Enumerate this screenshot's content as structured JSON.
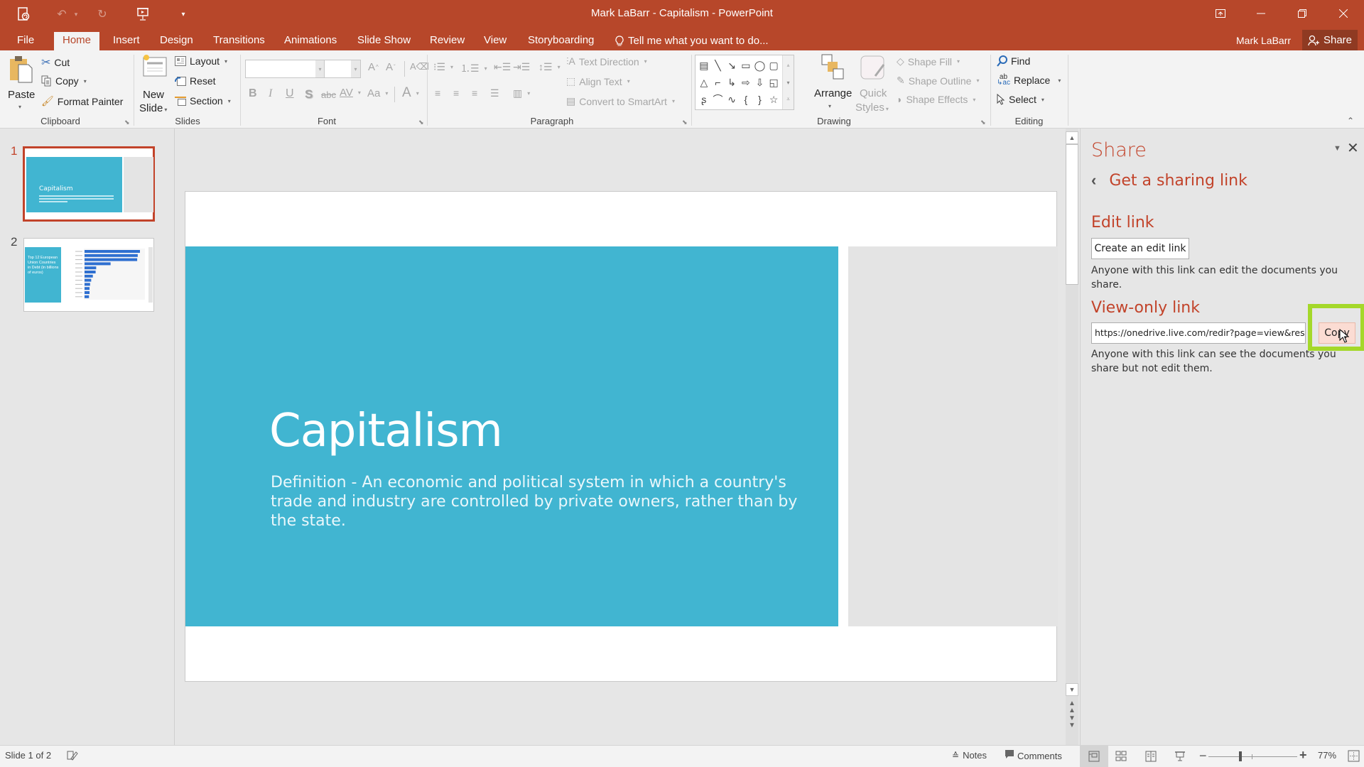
{
  "window": {
    "title": "Mark LaBarr - Capitalism - PowerPoint",
    "controls": {
      "ribbon_display": "▣",
      "minimize": "—",
      "restore": "❐",
      "close": "✕"
    }
  },
  "qat": {
    "autosave_icon": "autosave-icon",
    "undo_icon": "undo-icon",
    "redo_icon": "redo-icon",
    "start_slideshow_icon": "slideshow-icon",
    "customize_icon": "customize-qat-icon"
  },
  "tabs": [
    {
      "label": "File"
    },
    {
      "label": "Home",
      "active": true
    },
    {
      "label": "Insert"
    },
    {
      "label": "Design"
    },
    {
      "label": "Transitions"
    },
    {
      "label": "Animations"
    },
    {
      "label": "Slide Show"
    },
    {
      "label": "Review"
    },
    {
      "label": "View"
    },
    {
      "label": "Storyboarding"
    }
  ],
  "tell_me": "Tell me what you want to do...",
  "user": {
    "name": "Mark LaBarr",
    "share_label": "Share"
  },
  "ribbon": {
    "clipboard": {
      "label": "Clipboard",
      "paste": "Paste",
      "cut": "Cut",
      "copy": "Copy",
      "format_painter": "Format Painter"
    },
    "slides": {
      "label": "Slides",
      "new_slide_1": "New",
      "new_slide_2": "Slide",
      "layout": "Layout",
      "reset": "Reset",
      "section": "Section"
    },
    "font": {
      "label": "Font",
      "font_name": "",
      "font_size": "",
      "bold": "B",
      "italic": "I",
      "underline": "U",
      "shadow": "S",
      "strikethrough": "abc",
      "spacing": "AV",
      "change_case": "Aa",
      "font_color": "A",
      "grow": "A",
      "shrink": "A"
    },
    "paragraph": {
      "label": "Paragraph",
      "text_direction": "Text Direction",
      "align_text": "Align Text",
      "convert_smartart": "Convert to SmartArt"
    },
    "drawing": {
      "label": "Drawing",
      "arrange": "Arrange",
      "quick_styles_1": "Quick",
      "quick_styles_2": "Styles",
      "shape_fill": "Shape Fill",
      "shape_outline": "Shape Outline",
      "shape_effects": "Shape Effects",
      "shapes": [
        "▤",
        "╲",
        "↘",
        "▭",
        "◯",
        "▢",
        "△",
        "⌐",
        "↳",
        "⇨",
        "⇩",
        "◱",
        "ʂ",
        "⌒",
        "∿",
        "{",
        "}",
        "☆"
      ]
    },
    "editing": {
      "label": "Editing",
      "find": "Find",
      "replace": "Replace",
      "select": "Select"
    }
  },
  "thumbnails": [
    {
      "number": "1",
      "title": "Capitalism",
      "active": true
    },
    {
      "number": "2",
      "title": "Top 12 European Union Countries in Debt (in billions of euros)",
      "active": false
    }
  ],
  "slide": {
    "title": "Capitalism",
    "subtitle": "Definition - An economic and political system in which a country's trade and industry are controlled by private owners, rather than by the state.",
    "band_color": "#41b5d1"
  },
  "share_pane": {
    "title": "Share",
    "back_label": "Get a sharing link",
    "edit_heading": "Edit link",
    "edit_button": "Create an edit link",
    "edit_desc": "Anyone with this link can edit the documents you share.",
    "view_heading": "View-only link",
    "view_url": "https://onedrive.live.com/redir?page=view&resid=...",
    "copy_button": "Copy",
    "view_desc": "Anyone with this link can see the documents you share but not edit them.",
    "accent_color": "#c2432a",
    "highlight_color": "#a4d82a"
  },
  "status": {
    "slide_counter": "Slide 1 of 2",
    "notes": "Notes",
    "comments": "Comments",
    "zoom": "77%",
    "zoom_value_percent": 77
  }
}
